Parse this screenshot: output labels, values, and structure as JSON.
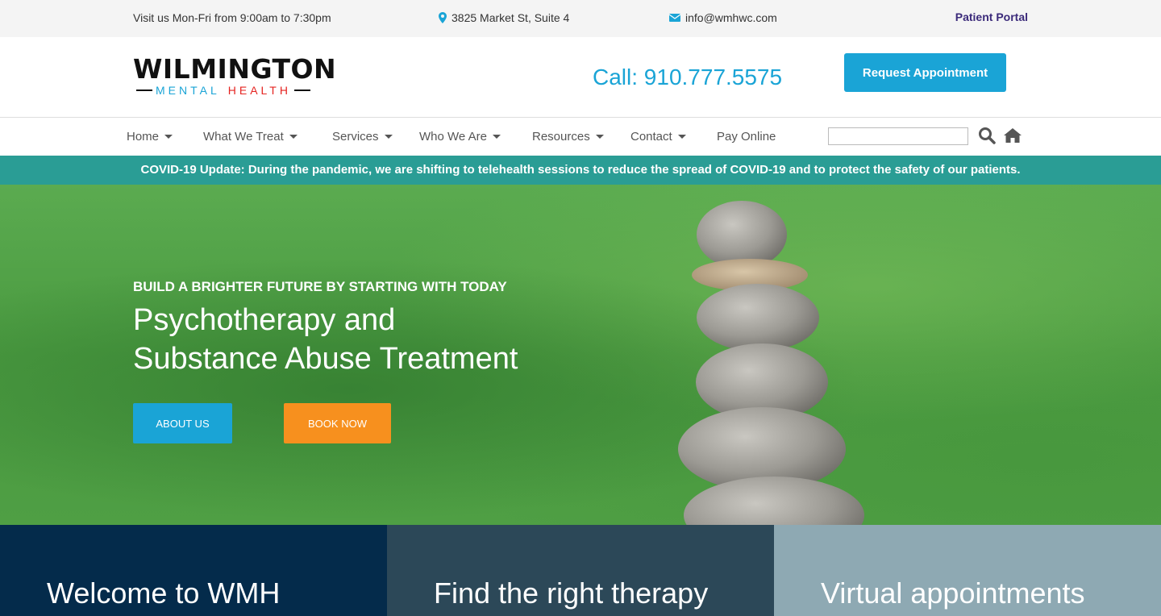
{
  "topbar": {
    "hours": "Visit us Mon-Fri from 9:00am to 7:30pm",
    "address": "3825 Market St, Suite 4",
    "email": "info@wmhwc.com",
    "portal": "Patient Portal"
  },
  "header": {
    "logo_top": "WILMINGTON",
    "logo_mental": "MENTAL",
    "logo_health": "HEALTH",
    "call_label": "Call:",
    "call_number": "910.777.5575",
    "request_button": "Request Appointment"
  },
  "nav": {
    "items": [
      "Home",
      "What We Treat",
      "Services",
      "Who We Are",
      "Resources",
      "Contact",
      "Pay Online"
    ],
    "search_placeholder": ""
  },
  "covid": "COVID-19 Update: During the pandemic, we are shifting to telehealth sessions to reduce the spread of COVID-19 and to protect the safety of our patients.",
  "hero": {
    "kicker": "BUILD A BRIGHTER FUTURE BY STARTING WITH TODAY",
    "title_line1": "Psychotherapy and",
    "title_line2": "Substance Abuse Treatment",
    "about_button": "ABOUT US",
    "book_button": "BOOK NOW"
  },
  "panels": [
    "Welcome to WMH",
    "Find the right therapy",
    "Virtual appointments"
  ],
  "colors": {
    "accent_blue": "#1aa4d6",
    "accent_orange": "#f7901e",
    "covid_teal": "#2a9d95",
    "portal_purple": "#3b2a7a"
  }
}
